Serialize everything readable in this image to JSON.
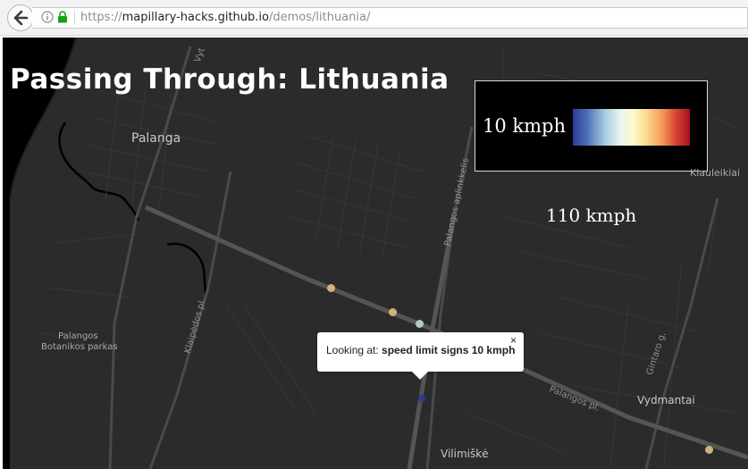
{
  "browser": {
    "url_scheme": "https://",
    "url_host": "mapillary-hacks.github.io",
    "url_path": "/demos/lithuania/"
  },
  "map": {
    "title": "Passing Through: Lithuania",
    "legend": {
      "min_label": "10 kmph",
      "max_label": "110 kmph"
    },
    "places": [
      "Palanga",
      "Palangos",
      "Botanikos parkas",
      "Klauleikiai",
      "Vydmantai",
      "Vilimiškė"
    ],
    "roads": [
      "Palangos aplinkkelis",
      "Klaipėdos pl.",
      "Palangos pl.",
      "Gintaro g.",
      "Vyt"
    ],
    "popup": {
      "prefix": "Looking at: ",
      "subject": "speed limit signs 10 kmph",
      "close": "×"
    },
    "colors": {
      "background": "#2b2b2b",
      "water": "#000000",
      "marker_tan": "#d2b27a",
      "marker_light": "#b9c6cc",
      "marker_blue": "#2c3b94"
    }
  }
}
